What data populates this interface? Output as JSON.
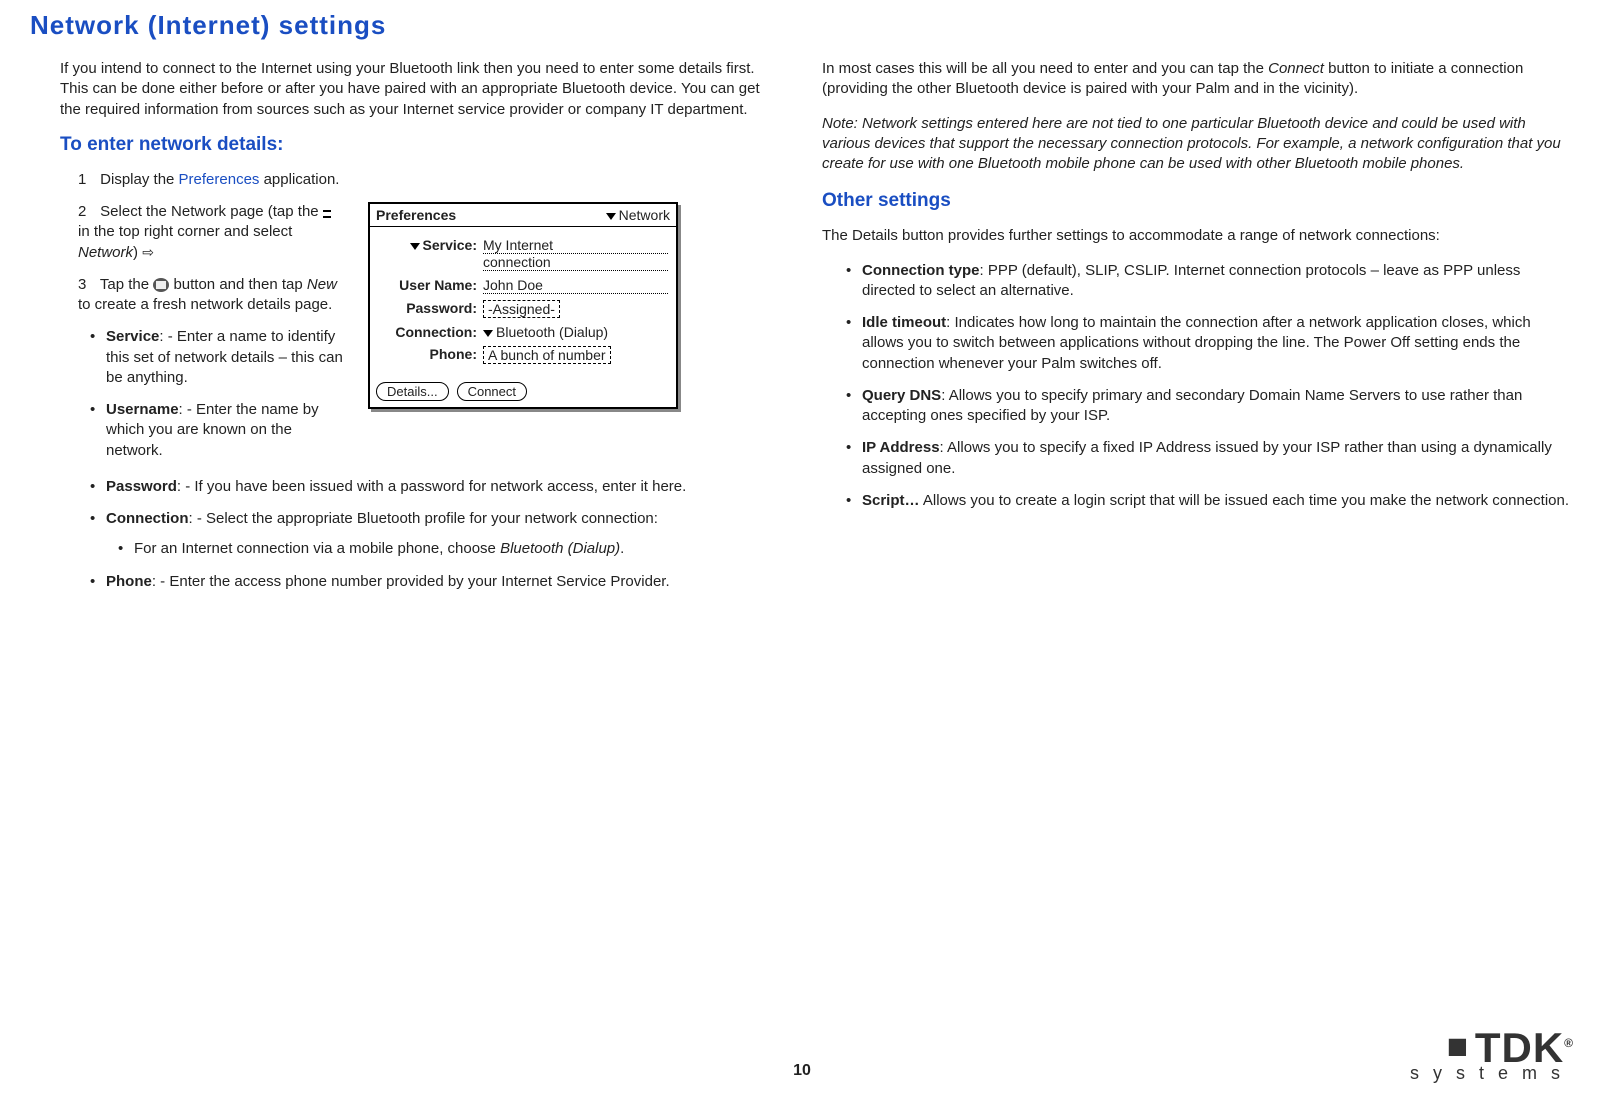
{
  "title": "Network (Internet) settings",
  "intro_left": "If you intend to connect to the Internet using your Bluetooth link then you need to enter some details first. This can be done either before or after you have paired with an appropriate Bluetooth device. You can get the required information from sources such as your Internet service provider or company IT department.",
  "section_enter": "To enter network details:",
  "steps": {
    "s1_num": "1",
    "s1_a": "Display the ",
    "s1_link": "Preferences",
    "s1_b": " application.",
    "s2_num": "2",
    "s2_a": "Select the Network page (tap the ",
    "s2_b": " in the top right corner and select ",
    "s2_c": "Network",
    "s2_d": ") ",
    "s3_num": "3",
    "s3_a": "Tap the ",
    "s3_b": " button and then tap ",
    "s3_c": "New",
    "s3_d": " to create a fresh network details page."
  },
  "fields": {
    "service_label": "Service",
    "service_text": ": - Enter a name to identify this set of network details – this can be anything.",
    "username_label": "Username",
    "username_text": ": - Enter the name by which you are known on the network.",
    "password_label": "Password",
    "password_text": ": - If you have been issued with a password for network access, enter it here.",
    "connection_label": "Connection",
    "connection_text": ": - Select the appropriate Bluetooth profile for your network connection:",
    "connection_sub_a": "For an Internet connection via a mobile phone, choose ",
    "connection_sub_b": "Bluetooth (Dialup)",
    "connection_sub_c": ".",
    "phone_label": "Phone",
    "phone_text": ": - Enter the access phone number provided by your Internet Service Provider."
  },
  "right": {
    "p1_a": "In most cases this will be all you need to enter and you can tap the ",
    "p1_b": "Connect",
    "p1_c": " button to initiate a connection (providing the other Bluetooth device is paired with your Palm and in the vicinity).",
    "note": "Note: Network settings entered here are not tied to one particular Bluetooth device and could be used with various devices that support the necessary connection protocols. For example, a network configuration that you create for use with one Bluetooth mobile phone can be used with other Bluetooth mobile phones.",
    "other_heading": "Other settings",
    "p2": "The Details button provides further settings to accommodate a range of network connections:",
    "items": {
      "ct_label": "Connection type",
      "ct_text": ": PPP (default), SLIP, CSLIP. Internet connection protocols – leave as PPP unless directed to select an alternative.",
      "idle_label": "Idle timeout",
      "idle_text": ": Indicates how long to maintain the connection after a network application closes, which allows you to switch between applications without dropping the line. The Power Off setting ends the connection whenever your Palm switches off.",
      "dns_label": "Query DNS",
      "dns_text": ": Allows you to specify primary and secondary Domain Name Servers to use rather than accepting ones specified by your ISP.",
      "ip_label": "IP Address",
      "ip_text": ": Allows you to specify a fixed IP Address issued by your ISP rather than using a dynamically assigned one.",
      "script_label": "Script…",
      "script_text": " Allows you to create a login script that will be issued each time you make the network connection."
    }
  },
  "palm": {
    "header_left": "Preferences",
    "header_right": "Network",
    "row_service_label": "Service:",
    "row_service_val1": "My Internet",
    "row_service_val2": "connection",
    "row_user_label": "User Name:",
    "row_user_val": "John Doe",
    "row_pass_label": "Password:",
    "row_pass_val": "-Assigned-",
    "row_conn_label": "Connection:",
    "row_conn_val": "Bluetooth (Dialup)",
    "row_phone_label": "Phone:",
    "row_phone_val": "A bunch of number",
    "btn_details": "Details...",
    "btn_connect": "Connect"
  },
  "page_number": "10",
  "logo_main": "TDK",
  "logo_sub": "systems"
}
